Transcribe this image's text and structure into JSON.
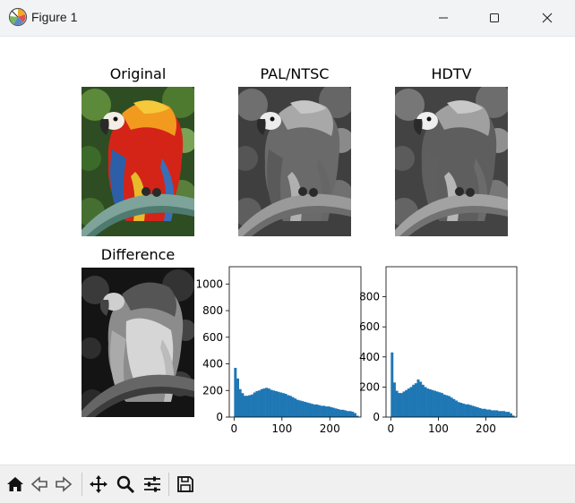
{
  "window": {
    "title": "Figure 1",
    "controls": [
      "minimize-icon",
      "maximize-icon",
      "close-icon"
    ]
  },
  "panels": {
    "original": {
      "title": "Original"
    },
    "pal": {
      "title": "PAL/NTSC"
    },
    "hdtv": {
      "title": "HDTV"
    },
    "difference": {
      "title": "Difference"
    }
  },
  "toolbar": {
    "icons": [
      "home-icon",
      "back-icon",
      "forward-icon",
      "pan-icon",
      "zoom-icon",
      "configure-subplots-icon",
      "save-icon"
    ]
  },
  "colors": {
    "bar": "#1f77b4",
    "titlebar": "#f1f3f5",
    "toolbar": "#f0f0f0"
  },
  "chart_data": [
    {
      "type": "bar",
      "title": "",
      "xlabel": "",
      "ylabel": "",
      "xlim": [
        -10,
        265
      ],
      "ylim": [
        0,
        1130
      ],
      "xticks": [
        "0",
        "100",
        "200"
      ],
      "yticks": [
        "0",
        "200",
        "400",
        "600",
        "800",
        "1000"
      ],
      "x": [
        0,
        5,
        10,
        15,
        20,
        25,
        30,
        35,
        40,
        45,
        50,
        55,
        60,
        65,
        70,
        75,
        80,
        85,
        90,
        95,
        100,
        105,
        110,
        115,
        120,
        125,
        130,
        135,
        140,
        145,
        150,
        155,
        160,
        165,
        170,
        175,
        180,
        185,
        190,
        195,
        200,
        205,
        210,
        215,
        220,
        225,
        230,
        235,
        240,
        245,
        250,
        255
      ],
      "values": [
        370,
        290,
        210,
        180,
        160,
        160,
        165,
        170,
        185,
        195,
        200,
        210,
        215,
        220,
        215,
        205,
        200,
        195,
        190,
        185,
        180,
        175,
        165,
        160,
        150,
        140,
        130,
        125,
        120,
        115,
        110,
        105,
        100,
        95,
        95,
        90,
        85,
        85,
        80,
        80,
        75,
        70,
        65,
        60,
        55,
        55,
        50,
        45,
        45,
        40,
        30,
        10
      ]
    },
    {
      "type": "bar",
      "title": "",
      "xlabel": "",
      "ylabel": "",
      "xlim": [
        -10,
        265
      ],
      "ylim": [
        0,
        1000
      ],
      "xticks": [
        "0",
        "100",
        "200"
      ],
      "yticks": [
        "0",
        "200",
        "400",
        "600",
        "800"
      ],
      "x": [
        0,
        5,
        10,
        15,
        20,
        25,
        30,
        35,
        40,
        45,
        50,
        55,
        60,
        65,
        70,
        75,
        80,
        85,
        90,
        95,
        100,
        105,
        110,
        115,
        120,
        125,
        130,
        135,
        140,
        145,
        150,
        155,
        160,
        165,
        170,
        175,
        180,
        185,
        190,
        195,
        200,
        205,
        210,
        215,
        220,
        225,
        230,
        235,
        240,
        245,
        250,
        255
      ],
      "values": [
        430,
        230,
        175,
        160,
        160,
        170,
        180,
        190,
        200,
        215,
        225,
        250,
        235,
        215,
        200,
        190,
        185,
        180,
        175,
        170,
        165,
        160,
        150,
        145,
        140,
        130,
        120,
        110,
        100,
        95,
        90,
        85,
        85,
        80,
        75,
        70,
        65,
        60,
        55,
        55,
        50,
        50,
        45,
        45,
        45,
        40,
        40,
        40,
        35,
        35,
        25,
        10
      ]
    }
  ]
}
